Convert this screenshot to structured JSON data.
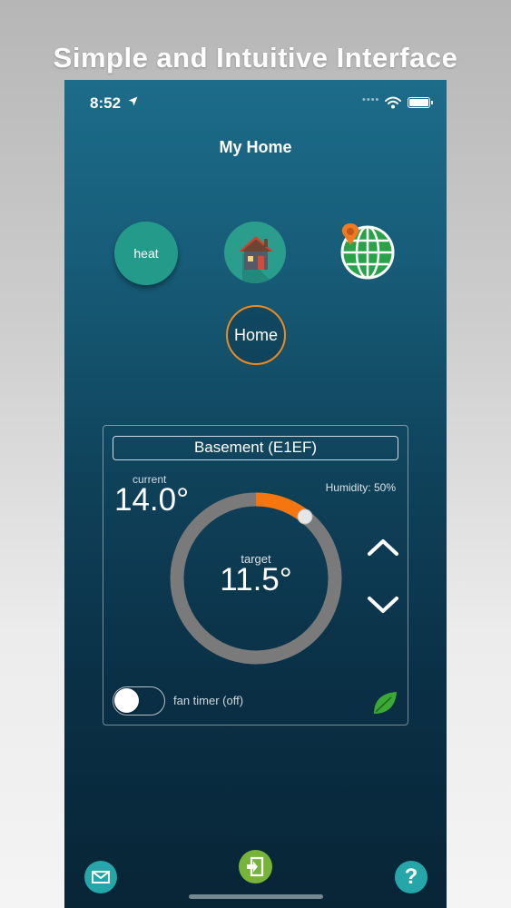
{
  "headline": "Simple and Intuitive Interface",
  "status_bar": {
    "time": "8:52"
  },
  "header": {
    "title": "My Home"
  },
  "modes": {
    "heat_label": "heat",
    "home_label": "Home"
  },
  "thermostat": {
    "zone_name": "Basement (E1EF)",
    "current_label": "current",
    "current_temp": "14.0°",
    "humidity": "Humidity: 50%",
    "target_label": "target",
    "target_temp": "11.5°",
    "fan_timer_label": "fan timer (off)"
  },
  "colors": {
    "accent_orange": "#f5760f",
    "teal": "#249a8a",
    "ring_gray": "#7a7a7a",
    "leaf_green": "#3aaa35",
    "exit_green": "#78b43a"
  },
  "icons": {
    "location": "location-arrow-icon",
    "wifi": "wifi-icon",
    "battery": "battery-icon",
    "house": "house-icon",
    "globe": "globe-location-icon",
    "up": "chevron-up-icon",
    "down": "chevron-down-icon",
    "leaf": "leaf-icon",
    "mail": "mail-icon",
    "exit": "exit-icon",
    "help": "help-icon"
  },
  "help_glyph": "?"
}
